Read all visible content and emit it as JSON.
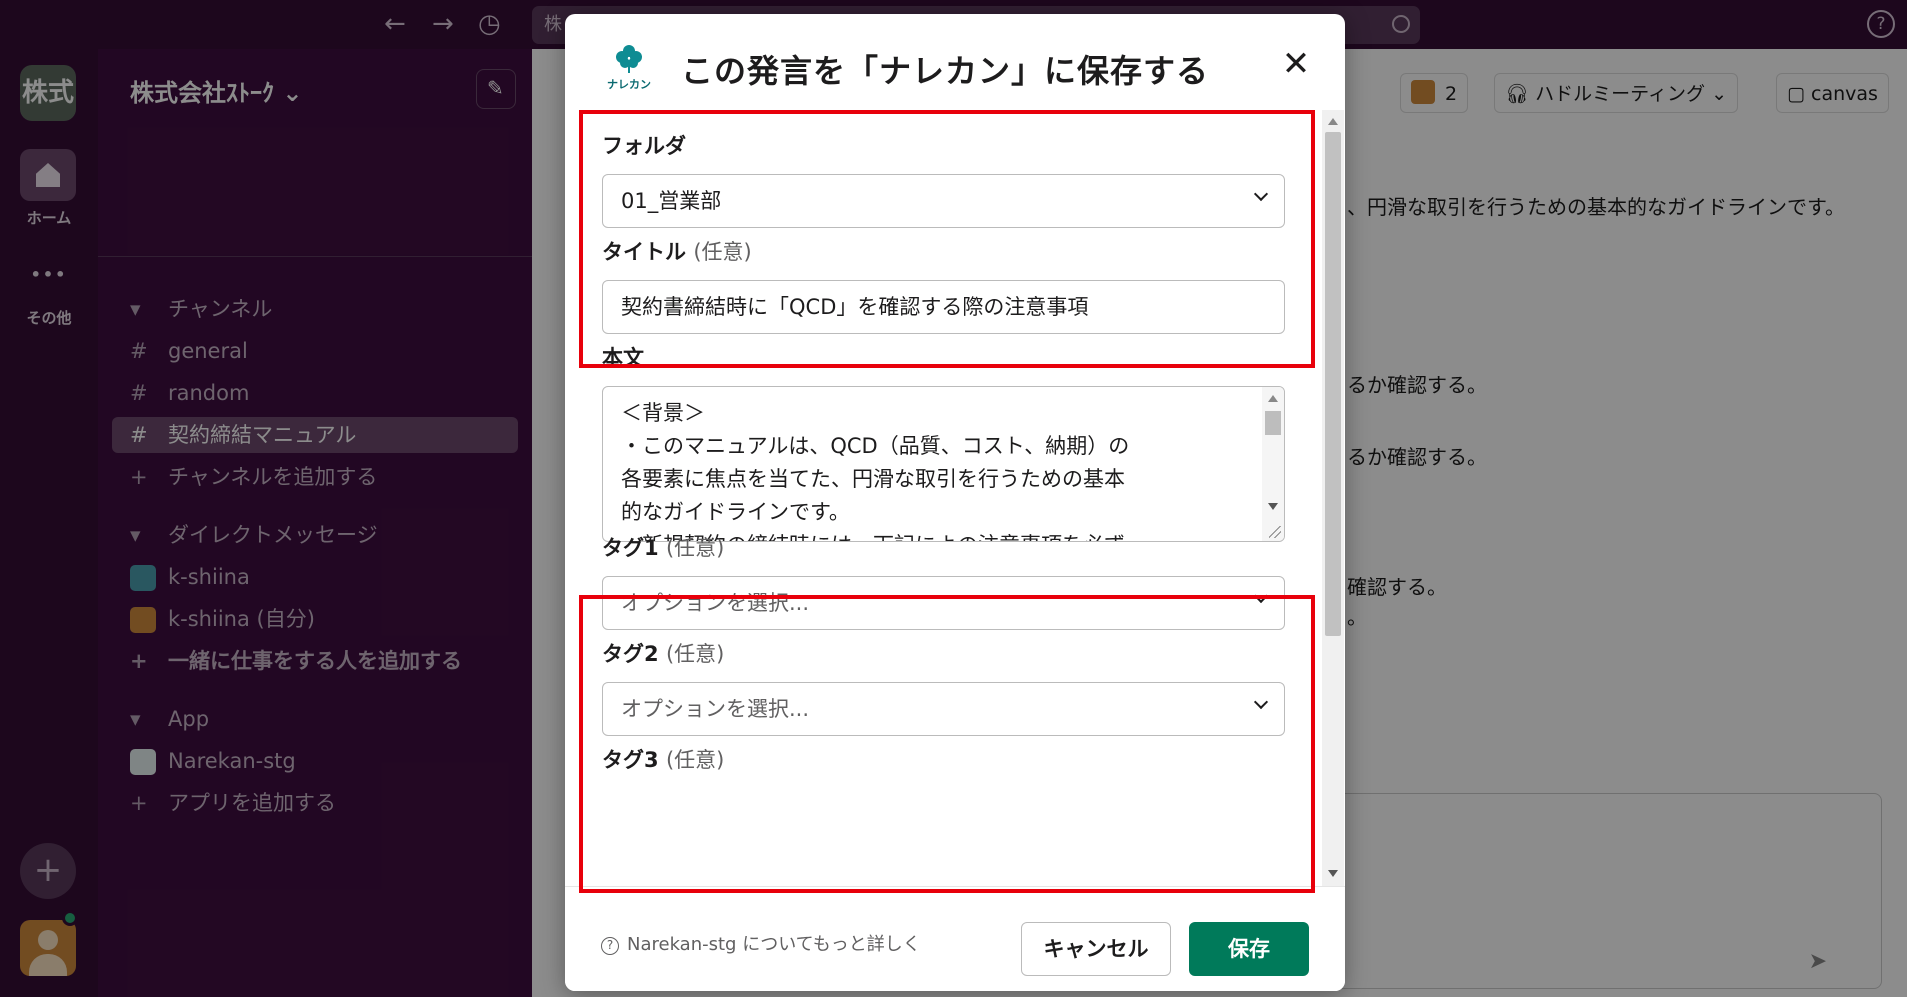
{
  "topbar": {
    "search_text": "株",
    "back_glyph": "←",
    "forward_glyph": "→",
    "history_glyph": "◷",
    "help_glyph": "?"
  },
  "rail": {
    "workspace_initials": "株式",
    "home_label": "ホーム",
    "more_glyph": "•••",
    "more_label": "その他",
    "add_glyph": "+"
  },
  "sidebar": {
    "workspace_name": "株式会社ｽﾄｰｸ ⌄",
    "channels_header": "チャンネル",
    "channels": [
      {
        "prefix": "#",
        "name": "general"
      },
      {
        "prefix": "#",
        "name": "random"
      },
      {
        "prefix": "#",
        "name": "契約締結マニュアル"
      },
      {
        "prefix": "+",
        "name": "チャンネルを追加する"
      }
    ],
    "dm_header": "ダイレクトメッセージ",
    "dms": [
      {
        "name": "k-shiina"
      },
      {
        "name": "k-shiina",
        "suffix": "(自分)"
      }
    ],
    "add_people": "一緒に仕事をする人を追加する",
    "add_people_prefix": "+",
    "app_header": "App",
    "apps": [
      {
        "name": "Narekan-stg"
      }
    ],
    "add_app": "アプリを追加する",
    "add_app_prefix": "+",
    "section_arrow": "▾"
  },
  "main": {
    "members_count": "2",
    "huddle_label": "ハドルミーティング",
    "canvas_label": "canvas",
    "lines": [
      "、円滑な取引を行うための基本的なガイドラインです。",
      "るか確認する。",
      "るか確認する。",
      "確認する。",
      "。"
    ]
  },
  "modal": {
    "logo_text": "ナレカン",
    "title": "この発言を「ナレカン」に保存する",
    "close_glyph": "✕",
    "folder_label": "フォルダ",
    "folder_value": "01_営業部",
    "title_label": "タイトル",
    "optional": "(任意)",
    "title_value": "契約書締結時に「QCD」を確認する際の注意事項",
    "body_label": "本文",
    "body_text": "＜背景＞\n・このマニュアルは、QCD（品質、コスト、納期）の\n各要素に焦点を当てた、円滑な取引を行うための基本\n的なガイドラインです。\n・新規契約の締結時には、下記によの注意事項を必ず",
    "tag1_label": "タグ1",
    "tag2_label": "タグ2",
    "tag3_label": "タグ3",
    "select_placeholder": "オプションを選択...",
    "learn_more_icon": "?",
    "learn_more": "Narekan-stg についてもっと詳しく",
    "cancel": "キャンセル",
    "save": "保存"
  },
  "colors": {
    "sidebar_bg": "#3f0e40",
    "save_button": "#007a5a",
    "highlight_border": "#e8000b"
  }
}
